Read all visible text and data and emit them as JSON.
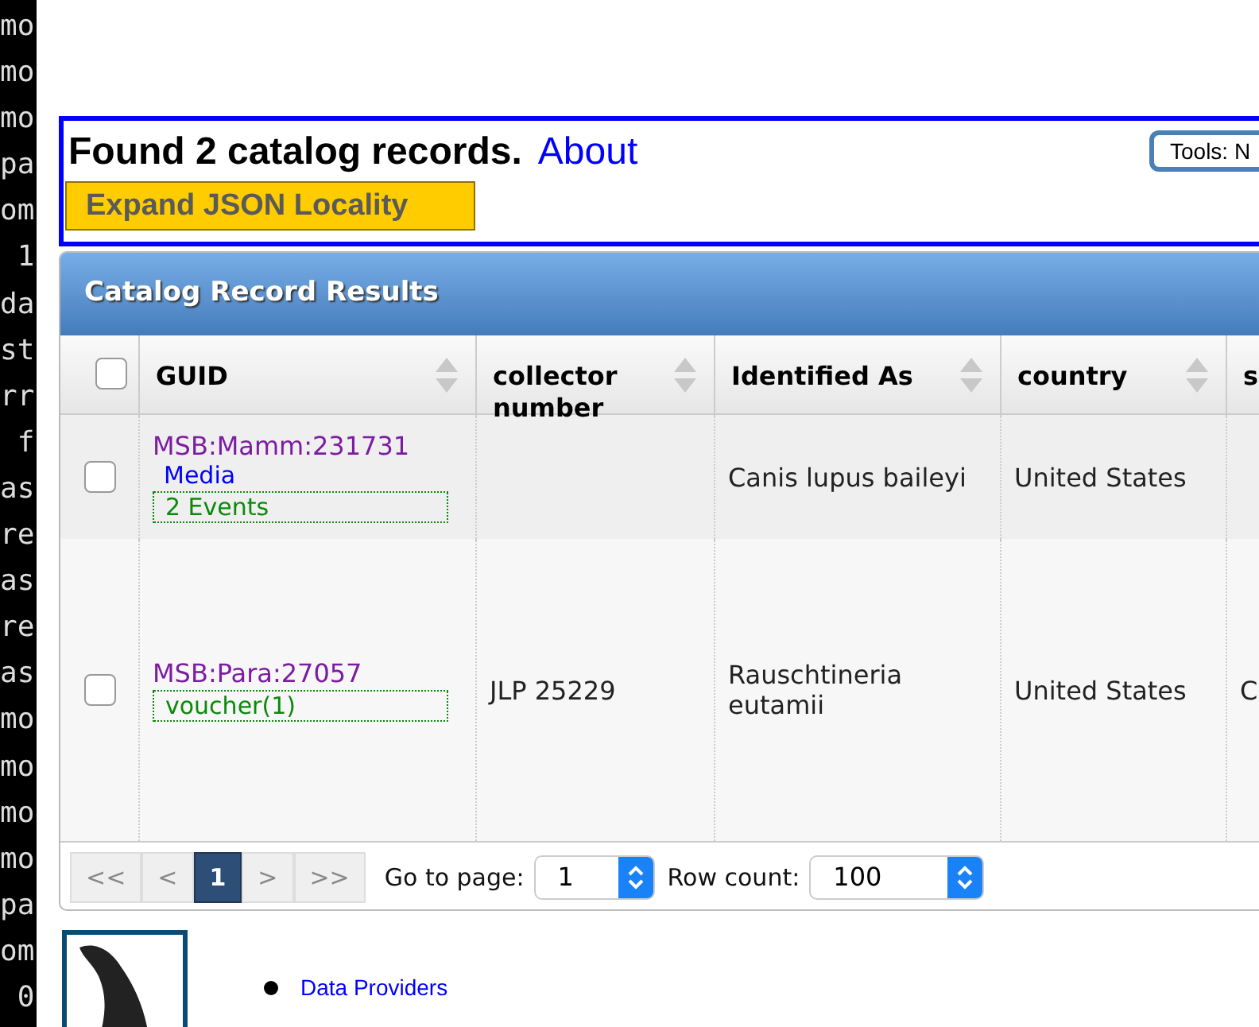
{
  "terminal": {
    "lines": [
      "mo",
      "mo",
      "mo",
      "pa",
      "om",
      " 1",
      "da",
      "st",
      "rr",
      " f",
      "as",
      "re",
      "as",
      "re",
      "as",
      "mo",
      "mo",
      "mo",
      "mo",
      "pa",
      "om",
      " 0"
    ]
  },
  "search_summary": {
    "title": "Found 2 catalog records.",
    "link": "About",
    "tools_select": "Tools: N",
    "expand_button": "Expand JSON Locality"
  },
  "results": {
    "title": "Catalog Record Results",
    "select_all_checked": false,
    "columns": [
      {
        "label": "GUID",
        "sortable": true
      },
      {
        "label": "collector number",
        "sortable": true
      },
      {
        "label": "Identified As",
        "sortable": true
      },
      {
        "label": "country",
        "sortable": true
      },
      {
        "label": "s",
        "sortable": false
      }
    ],
    "rows": [
      {
        "checked": false,
        "guid": "MSB:Mamm:231731",
        "media_link": "Media",
        "relation": "2 Events",
        "collector_number": "",
        "identified_as": "Canis lupus baileyi",
        "country": "United States",
        "column_5": ""
      },
      {
        "checked": false,
        "guid": "MSB:Para:27057",
        "relation": "voucher(1)",
        "collector_number": "JLP 25229",
        "identified_as": "Rauschtineria eutamii",
        "country": "United States",
        "column_5": "C"
      }
    ],
    "pager": {
      "buttons": [
        {
          "label": "<<",
          "selected": false
        },
        {
          "label": "<",
          "selected": false
        },
        {
          "label": "1",
          "selected": true
        },
        {
          "label": ">",
          "selected": false
        },
        {
          "label": ">>",
          "selected": false
        }
      ],
      "goto_label": "Go to page:",
      "goto_value": "1",
      "rowcount_label": "Row count:",
      "rowcount_value": "100"
    }
  },
  "footer": {
    "links": [
      "Data Providers"
    ]
  }
}
